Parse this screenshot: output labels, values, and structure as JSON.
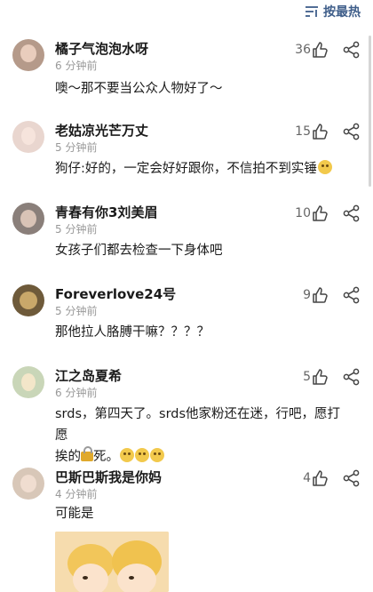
{
  "sort": {
    "label": "按最热",
    "icon": "sort-icon"
  },
  "comments": [
    {
      "name": "橘子气泡泡水呀",
      "time": "6 分钟前",
      "likes": "36",
      "text": "噢～那不要当公众人物好了～",
      "avatar_color": "#b59a8a"
    },
    {
      "name": "老姑凉光芒万丈",
      "time": "5 分钟前",
      "likes": "15",
      "text": "狗仔:好的，一定会好好跟你，不信拍不到实锤",
      "avatar_color": "#e9d6cf"
    },
    {
      "name": "青春有你3刘美眉",
      "time": "5 分钟前",
      "likes": "10",
      "text": "女孩子们都去检查一下身体吧",
      "avatar_color": "#8a7f7a"
    },
    {
      "name": "Foreverlove24号",
      "time": "5 分钟前",
      "likes": "9",
      "text": "那他拉人胳膊干嘛？？？？",
      "avatar_color": "#6e5a3a"
    },
    {
      "name": "江之岛夏希",
      "time": "6 分钟前",
      "likes": "5",
      "text_line1": "srds，第四天了。srds他家粉还在迷，行吧，愿打愿",
      "text_line2a": "挨的",
      "text_line2b": "死。",
      "avatar_color": "#c9d6b8"
    },
    {
      "name": "巴斯巴斯我是你妈",
      "time": "4 分钟前",
      "likes": "4",
      "text": "可能是",
      "avatar_color": "#d8c7b8"
    }
  ]
}
